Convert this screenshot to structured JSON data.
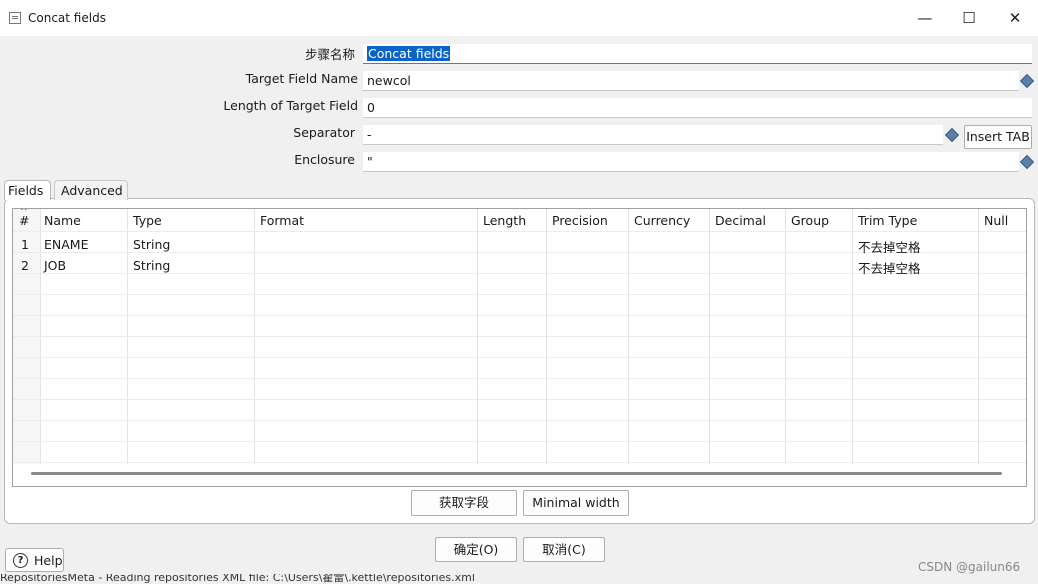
{
  "window": {
    "title": "Concat fields",
    "minimize": "—",
    "maximize": "☐",
    "close": "✕"
  },
  "form": {
    "step_name_label": "步骤名称",
    "step_name_value": "Concat fields",
    "target_field_label": "Target Field Name",
    "target_field_value": "newcol",
    "length_label": "Length of Target Field",
    "length_value": "0",
    "separator_label": "Separator",
    "separator_value": "-",
    "insert_tab_label": "Insert TAB",
    "enclosure_label": "Enclosure",
    "enclosure_value": "\""
  },
  "tabs": [
    {
      "label": "Fields",
      "active": true
    },
    {
      "label": "Advanced",
      "active": false
    }
  ],
  "grid": {
    "columns": [
      "#",
      "Name",
      "Type",
      "Format",
      "Length",
      "Precision",
      "Currency",
      "Decimal",
      "Group",
      "Trim Type",
      "Null"
    ],
    "rows": [
      {
        "num": "1",
        "name": "ENAME",
        "type": "String",
        "trim": "不去掉空格"
      },
      {
        "num": "2",
        "name": "JOB",
        "type": "String",
        "trim": "不去掉空格"
      }
    ]
  },
  "buttons": {
    "get_fields": "获取字段",
    "minimal_width": "Minimal width",
    "ok": "确定(O)",
    "cancel": "取消(C)",
    "help": "Help"
  },
  "status_text": "RepositoriesMeta - Reading repositories XML file: C:\\Users\\翟雷\\.kettle\\repositories.xml",
  "watermark": "CSDN @gailun66",
  "colors": {
    "selection": "#0a64c8",
    "variable_icon": "#5a7fa8"
  }
}
